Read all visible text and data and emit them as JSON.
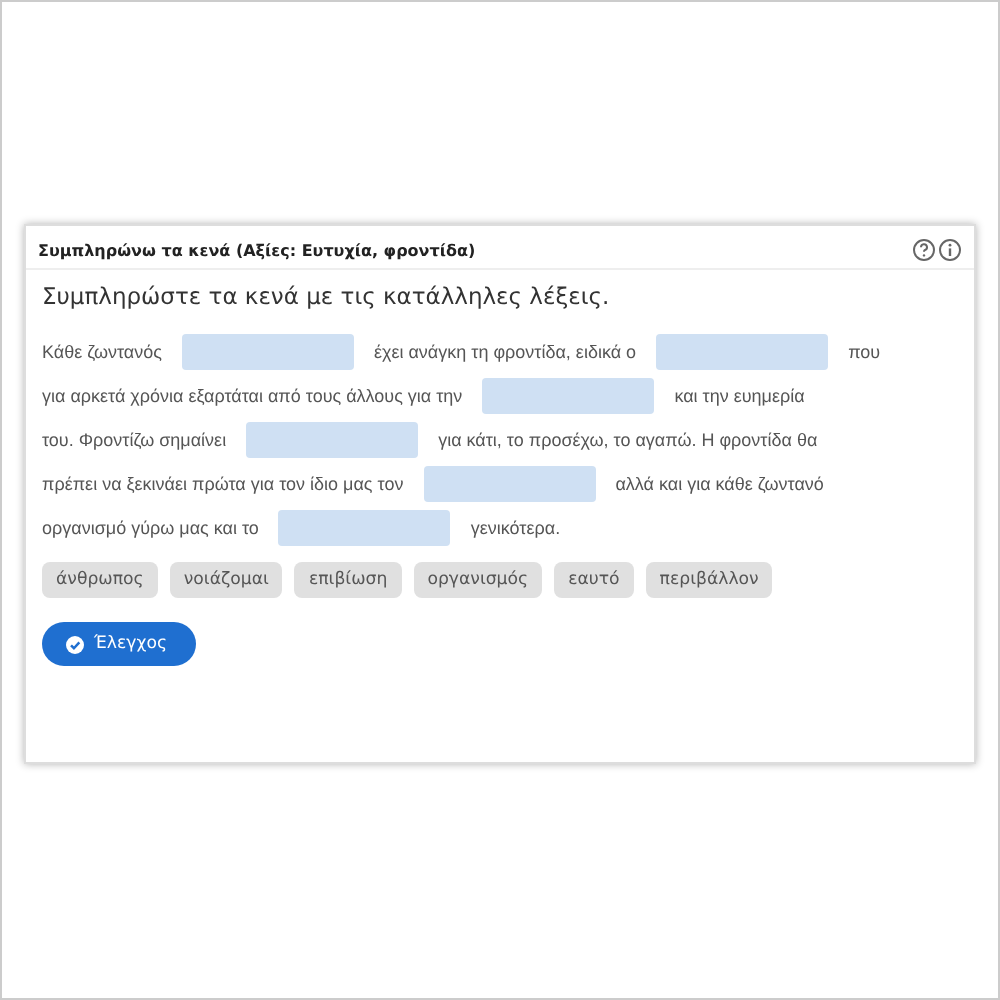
{
  "header": {
    "title": "Συμπληρώνω τα κενά (Αξίες: Ευτυχία, φροντίδα)"
  },
  "instruction": "Συμπληρώστε τα κενά με τις κατάλληλες λέξεις.",
  "passage_lines": [
    [
      {
        "kind": "text",
        "text": "Κάθε ζωντανός"
      },
      {
        "kind": "blank"
      },
      {
        "kind": "text",
        "text": "έχει ανάγκη τη φροντίδα, ειδικά ο"
      },
      {
        "kind": "blank"
      },
      {
        "kind": "text",
        "text": "που"
      }
    ],
    [
      {
        "kind": "text",
        "text": "για αρκετά χρόνια εξαρτάται από τους άλλους για την"
      },
      {
        "kind": "blank"
      },
      {
        "kind": "text",
        "text": "και την ευημερία"
      }
    ],
    [
      {
        "kind": "text",
        "text": "του. Φροντίζω σημαίνει"
      },
      {
        "kind": "blank"
      },
      {
        "kind": "text",
        "text": "για κάτι, το προσέχω, το αγαπώ. Η φροντίδα θα"
      }
    ],
    [
      {
        "kind": "text",
        "text": "πρέπει να ξεκινάει πρώτα για τον ίδιο μας τον"
      },
      {
        "kind": "blank"
      },
      {
        "kind": "text",
        "text": "αλλά και για κάθε ζωντανό"
      }
    ],
    [
      {
        "kind": "text",
        "text": "οργανισμό γύρω μας και το"
      },
      {
        "kind": "blank"
      },
      {
        "kind": "text",
        "text": "γενικότερα."
      }
    ]
  ],
  "words": [
    "άνθρωπος",
    "νοιάζομαι",
    "επιβίωση",
    "οργανισμός",
    "εαυτό",
    "περιβάλλον"
  ],
  "check_button": {
    "label": "Έλεγχος"
  }
}
